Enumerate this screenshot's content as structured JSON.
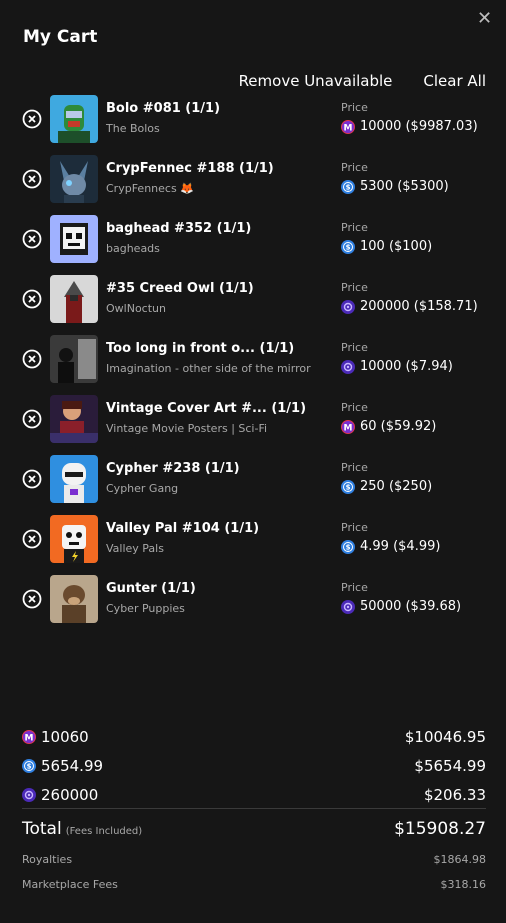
{
  "cart": {
    "title": "My Cart",
    "remove_unavailable": "Remove Unavailable",
    "clear_all": "Clear All",
    "price_label": "Price"
  },
  "items": [
    {
      "name": "Bolo #081 (1/1)",
      "collection": "The Bolos",
      "coin": "mana",
      "price": "10000 ($9987.03)"
    },
    {
      "name": "CrypFennec #188 (1/1)",
      "collection": "CrypFennecs 🦊",
      "coin": "usdc",
      "price": "5300 ($5300)"
    },
    {
      "name": "baghead #352 (1/1)",
      "collection": "bagheads",
      "coin": "usdc",
      "price": "100 ($100)"
    },
    {
      "name": "#35 Creed Owl (1/1)",
      "collection": "OwlNoctun",
      "coin": "purple",
      "price": "200000 ($158.71)"
    },
    {
      "name": "Too long in front o... (1/1)",
      "collection": "Imagination - other side of the mirror",
      "coin": "purple",
      "price": "10000 ($7.94)"
    },
    {
      "name": "Vintage Cover Art #... (1/1)",
      "collection": "Vintage Movie Posters | Sci-Fi",
      "coin": "mana",
      "price": "60 ($59.92)"
    },
    {
      "name": "Cypher #238 (1/1)",
      "collection": "Cypher Gang",
      "coin": "usdc",
      "price": "250 ($250)"
    },
    {
      "name": "Valley Pal #104 (1/1)",
      "collection": "Valley Pals",
      "coin": "usdc",
      "price": "4.99 ($4.99)"
    },
    {
      "name": "Gunter (1/1)",
      "collection": "Cyber Puppies",
      "coin": "purple",
      "price": "50000 ($39.68)"
    }
  ],
  "totals": [
    {
      "coin": "mana",
      "amount": "10060",
      "usd": "$10046.95"
    },
    {
      "coin": "usdc",
      "amount": "5654.99",
      "usd": "$5654.99"
    },
    {
      "coin": "purple",
      "amount": "260000",
      "usd": "$206.33"
    }
  ],
  "summary": {
    "total_label": "Total",
    "fees_note": "(Fees Included)",
    "total_value": "$15908.27",
    "royalties_label": "Royalties",
    "royalties_value": "$1864.98",
    "marketplace_label": "Marketplace Fees",
    "marketplace_value": "$318.16"
  },
  "colors": {
    "background": "#161616",
    "mana": "#e0364f",
    "usdc": "#2f7fe0",
    "purple": "#4b2ab8"
  }
}
